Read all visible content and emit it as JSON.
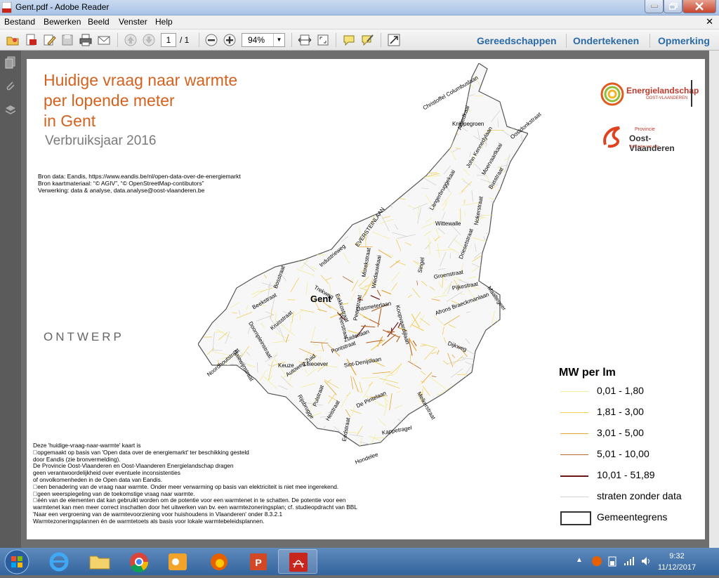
{
  "window": {
    "title": "Gent.pdf - Adobe Reader"
  },
  "menu": {
    "items": [
      "Bestand",
      "Bewerken",
      "Beeld",
      "Venster",
      "Help"
    ]
  },
  "toolbar": {
    "page_current": "1",
    "page_total": "/ 1",
    "zoom": "94%",
    "links": [
      "Gereedschappen",
      "Ondertekenen",
      "Opmerking"
    ]
  },
  "map": {
    "title_lines": [
      "Huidige vraag naar warmte",
      "per lopende meter",
      "in Gent"
    ],
    "subtitle": "Verbruiksjaar 2016",
    "sources": [
      "Bron data: Eandis, https://www.eandis.be/nl/open-data-over-de-energiemarkt",
      "Bron kaartmateriaal: “© AGIV”, “© OpenStreetMap-contibutors”",
      "Verwerking: data & analyse, data.analyse@oost-vlaanderen.be"
    ],
    "watermark": "ONTWERP",
    "city_label": "Gent",
    "logos": {
      "energielandschap": "Energielandschap",
      "energielandschap_sub": "OOST-VLAANDEREN",
      "provincie": "Provincie",
      "oost_vlaanderen": "Oost-Vlaanderen",
      "tagline": "Voor ieder van ons"
    },
    "notes": [
      "Deze 'huidige-vraag-naar-warmte' kaart is",
      "opgemaakt op basis van 'Open data over de energiemarkt' ter beschikking gesteld",
      "door Eandis (zie bronvermelding).",
      "De Provincie Oost-Vlaanderen en Oost-Vlaanderen Energielandschap dragen",
      "geen verantwoordelijkheid over eventuele inconsistenties",
      "of onvolkomenheden in de Open data van Eandis.",
      "een benadering van de vraag naar warmte. Onder meer verwarming op basis van elektriciteit is niet mee ingerekend.",
      "geen weerspiegeling van de toekomstige vraag naar warmte.",
      "één van de elementen dat kan gebruikt worden om de potentie voor een warmtenet in te schatten. De potentie voor een",
      "warmtenet kan men meer correct inschatten door het uitwerken van bv. een warmtezoneringsplan; cf. studieopdracht van BBL",
      "'Naar een vergroening van de warmtevoorziening voor huishoudens in Vlaanderen' onder 8.3.2.1",
      "Warmtezoneringsplannen én de warmtetoets als basis voor lokale warmtebeleidsplannen."
    ],
    "streets": [
      "Christoffel Columbuslaan",
      "Knippegroen",
      "Oostdonkstraat",
      "Arbedkaai",
      "John Kennedylaan",
      "Moervaartkaai",
      "Busstraat",
      "Langerbruggekaai",
      "Nokerstraat",
      "Wittewalle",
      "EVERSTEINLAAN",
      "Industrieweg",
      "Driesetstraat",
      "Singel",
      "Groenstraat",
      "Pijkestraat",
      "Maaltegeer",
      "Bosstraat",
      "Trekweg",
      "Eekkostraat",
      "Morekstraat",
      "Wiedauwkaai",
      "Koopvaardijlaan",
      "Peerstraat",
      "Dasmeterlaan",
      "Afrons Braeckmanlaan",
      "Beekstraat",
      "Kruisstraat",
      "Doornpleinstraat",
      "Peerstraat",
      "Zuiderlaan",
      "Halewijnstraat",
      "Pontstraat",
      "Dijkweg",
      "Noordhoutstraat",
      "Leieoever",
      "Keuze",
      "Sint-Denijslaan",
      "Autoweg-Zuid",
      "Rijsbrugge",
      "De Pintelaan",
      "Pulstraat",
      "Melkerstraat",
      "Heistraat",
      "Kappetragel",
      "Eedstraat",
      "Hondelee"
    ]
  },
  "legend": {
    "title": "MW per lm",
    "items": [
      {
        "label": "0,01 - 1,80",
        "color": "#f3ec9b"
      },
      {
        "label": "1,81 - 3,00",
        "color": "#efcf5a"
      },
      {
        "label": "3,01 - 5,00",
        "color": "#e5a430"
      },
      {
        "label": "5,01 - 10,00",
        "color": "#b86a2c"
      },
      {
        "label": "10,01 - 51,89",
        "color": "#6b1718"
      }
    ],
    "no_data": {
      "label": "straten zonder data",
      "color": "#d2d2d2"
    },
    "boundary": {
      "label": "Gemeentegrens"
    }
  },
  "taskbar": {
    "apps": [
      "start-button",
      "internet-explorer-icon",
      "file-explorer-icon",
      "chrome-icon",
      "outlook-icon",
      "firefox-icon",
      "powerpoint-icon",
      "adobe-reader-icon"
    ],
    "time": "9:32",
    "date": "11/12/2017"
  }
}
